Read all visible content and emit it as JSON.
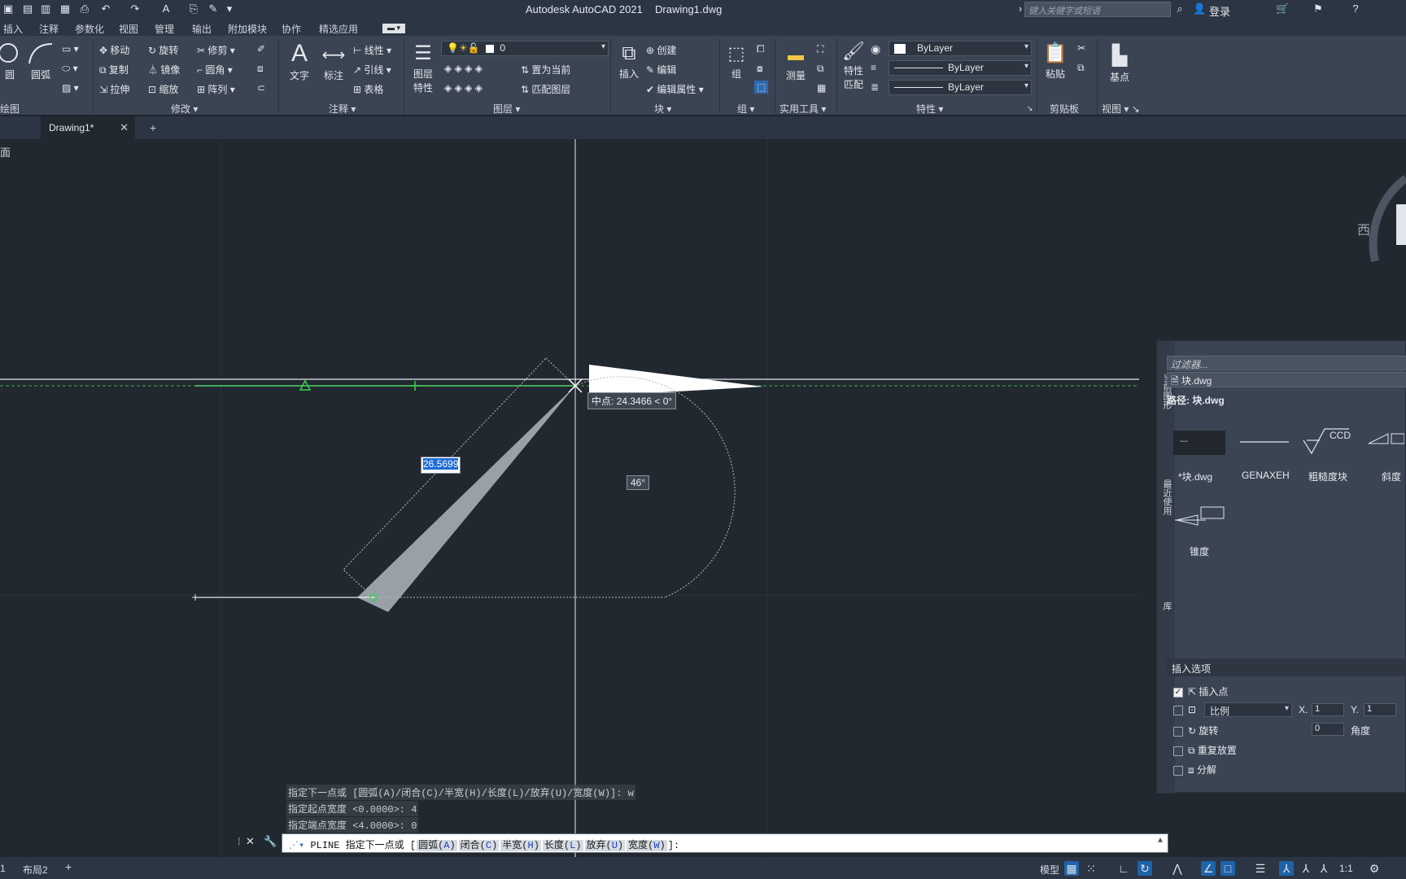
{
  "window": {
    "title": "Autodesk AutoCAD 2021",
    "document": "Drawing1.dwg"
  },
  "search": {
    "placeholder": "键入关键字或短语"
  },
  "account": {
    "login": "登录"
  },
  "menu": [
    "插入",
    "注释",
    "参数化",
    "视图",
    "管理",
    "输出",
    "附加模块",
    "协作",
    "精选应用"
  ],
  "ribbon": {
    "draw": {
      "circle": "圆",
      "arc": "圆弧",
      "panel": "绘图"
    },
    "modify": {
      "move": "移动",
      "rotate": "旋转",
      "trim": "修剪",
      "copy": "复制",
      "mirror": "镜像",
      "fillet": "圆角",
      "stretch": "拉伸",
      "scale": "缩放",
      "array": "阵列",
      "panel": "修改"
    },
    "annotation": {
      "text": "文字",
      "dimension": "标注",
      "linear": "线性",
      "leader": "引线",
      "table": "表格",
      "panel": "注释"
    },
    "layers": {
      "properties": "图层",
      "properties2": "特性",
      "current_layer": "0",
      "make_current": "置为当前",
      "match_layer": "匹配图层",
      "panel": "图层"
    },
    "block": {
      "insert": "插入",
      "create": "创建",
      "edit": "编辑",
      "edit_attributes": "编辑属性",
      "panel": "块"
    },
    "groups": {
      "group": "组",
      "panel": "组"
    },
    "utilities": {
      "measure": "测量",
      "panel": "实用工具"
    },
    "properties": {
      "match": "特性",
      "match2": "匹配",
      "color": "ByLayer",
      "linetype": "ByLayer",
      "lineweight": "ByLayer",
      "panel": "特性"
    },
    "clipboard": {
      "paste": "粘贴",
      "panel": "剪贴板"
    },
    "view": {
      "base": "基点",
      "panel": "视图"
    }
  },
  "tabs": {
    "active": "Drawing1*",
    "add": "+"
  },
  "viewport": {
    "label": "[-][俯视][二维线框]",
    "label_visible": "面"
  },
  "viewcube": {
    "west": "西"
  },
  "drawing": {
    "tooltip_midpoint": "中点: 24.3466 < 0°",
    "dyn_length": "26.5699",
    "dyn_angle": "46°"
  },
  "command": {
    "history": [
      "指定下一点或 [圆弧(A)/闭合(C)/半宽(H)/长度(L)/放弃(U)/宽度(W)]: w",
      "指定起点宽度 <0.0000>: 4",
      "指定端点宽度 <4.0000>: 0"
    ],
    "prompt_prefix": "PLINE 指定下一点或 [",
    "options": [
      {
        "label": "圆弧(",
        "key": "A",
        "end": ")"
      },
      {
        "label": "闭合(",
        "key": "C",
        "end": ")"
      },
      {
        "label": "半宽(",
        "key": "H",
        "end": ")"
      },
      {
        "label": "长度(",
        "key": "L",
        "end": ")"
      },
      {
        "label": "放弃(",
        "key": "U",
        "end": ")"
      },
      {
        "label": "宽度(",
        "key": "W",
        "end": ")"
      }
    ],
    "prompt_suffix": "]:"
  },
  "palette": {
    "filter_placeholder": "过滤器...",
    "file": "块.dwg",
    "path_label": "路径: 块.dwg",
    "side_tabs": [
      "当前图形",
      "最近使用",
      "库"
    ],
    "blocks": [
      {
        "name": "*块.dwg",
        "preview": "---"
      },
      {
        "name": "GENAXEH",
        "preview": ""
      },
      {
        "name": "粗糙度块",
        "preview": "CCD"
      },
      {
        "name": "斜度",
        "preview": "∠N"
      },
      {
        "name": "锥度",
        "preview": "▷N"
      }
    ],
    "insert_options_title": "插入选项",
    "options": {
      "insertion_point": "插入点",
      "scale": "比例",
      "scale_x_label": "X.",
      "scale_x": "1",
      "scale_y_label": "Y.",
      "scale_y": "1",
      "rotation": "旋转",
      "rotation_value": "0",
      "angle_label": "角度",
      "repeat": "重复放置",
      "explode": "分解"
    }
  },
  "status": {
    "layout1": "1",
    "layout2": "布局2",
    "add": "+",
    "model": "模型",
    "scale": "1:1"
  },
  "colors": {
    "canvas": "#212830",
    "ribbon": "#3b4453",
    "accent": "#1f63a9",
    "snap_green": "#34c759"
  }
}
